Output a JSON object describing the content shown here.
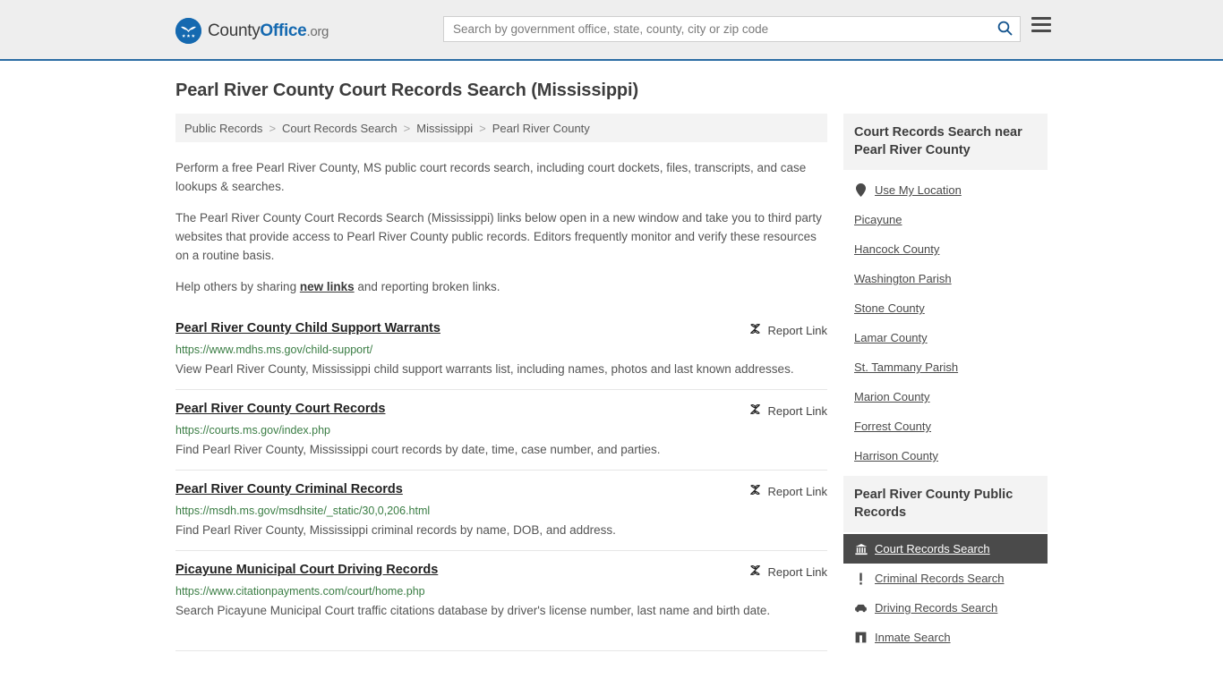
{
  "header": {
    "logo": {
      "part1": "County",
      "part2": "Office",
      "part3": ".org",
      "icon": "eagle-shield-logo"
    },
    "search": {
      "placeholder": "Search by government office, state, county, city or zip code",
      "value": "",
      "button_icon": "search-icon"
    },
    "menu_icon": "hamburger-menu-icon"
  },
  "page": {
    "title": "Pearl River County Court Records Search (Mississippi)"
  },
  "breadcrumb": {
    "items": [
      {
        "label": "Public Records",
        "current": false
      },
      {
        "label": "Court Records Search",
        "current": false
      },
      {
        "label": "Mississippi",
        "current": false
      },
      {
        "label": "Pearl River County",
        "current": true
      }
    ],
    "separator": ">"
  },
  "intro": {
    "p1": "Perform a free Pearl River County, MS public court records search, including court dockets, files, transcripts, and case lookups & searches.",
    "p2": "The Pearl River County Court Records Search (Mississippi) links below open in a new window and take you to third party websites that provide access to Pearl River County public records. Editors frequently monitor and verify these resources on a routine basis.",
    "p3_before": "Help others by sharing ",
    "p3_link": "new links",
    "p3_after": " and reporting broken links."
  },
  "report_link": {
    "label": "Report Link",
    "icon": "broken-link-icon"
  },
  "results": [
    {
      "title": "Pearl River County Child Support Warrants",
      "url": "https://www.mdhs.ms.gov/child-support/",
      "description": "View Pearl River County, Mississippi child support warrants list, including names, photos and last known addresses."
    },
    {
      "title": "Pearl River County Court Records",
      "url": "https://courts.ms.gov/index.php",
      "description": "Find Pearl River County, Mississippi court records by date, time, case number, and parties."
    },
    {
      "title": "Pearl River County Criminal Records",
      "url": "https://msdh.ms.gov/msdhsite/_static/30,0,206.html",
      "description": "Find Pearl River County, Mississippi criminal records by name, DOB, and address."
    },
    {
      "title": "Picayune Municipal Court Driving Records",
      "url": "https://www.citationpayments.com/court/home.php",
      "description": "Search Picayune Municipal Court traffic citations database by driver's license number, last name and birth date."
    }
  ],
  "sidebar": {
    "nearby": {
      "title": "Court Records Search near Pearl River County",
      "use_my_location": {
        "label": "Use My Location",
        "icon": "map-pin-icon"
      },
      "links": [
        {
          "label": "Picayune"
        },
        {
          "label": "Hancock County"
        },
        {
          "label": "Washington Parish"
        },
        {
          "label": "Stone County"
        },
        {
          "label": "Lamar County"
        },
        {
          "label": "St. Tammany Parish"
        },
        {
          "label": "Marion County"
        },
        {
          "label": "Forrest County"
        },
        {
          "label": "Harrison County"
        }
      ]
    },
    "public_records": {
      "title": "Pearl River County Public Records",
      "links": [
        {
          "label": "Court Records Search",
          "icon": "courthouse-icon",
          "active": true
        },
        {
          "label": "Criminal Records Search",
          "icon": "exclamation-icon",
          "active": false
        },
        {
          "label": "Driving Records Search",
          "icon": "car-icon",
          "active": false
        },
        {
          "label": "Inmate Search",
          "icon": "jail-building-icon",
          "active": false
        }
      ]
    }
  },
  "colors": {
    "brand_blue": "#1569b0",
    "header_bg": "#eeeeee",
    "url_green": "#3a7d44",
    "active_bg": "#4a4a4a",
    "panel_bg": "#f3f3f3"
  }
}
